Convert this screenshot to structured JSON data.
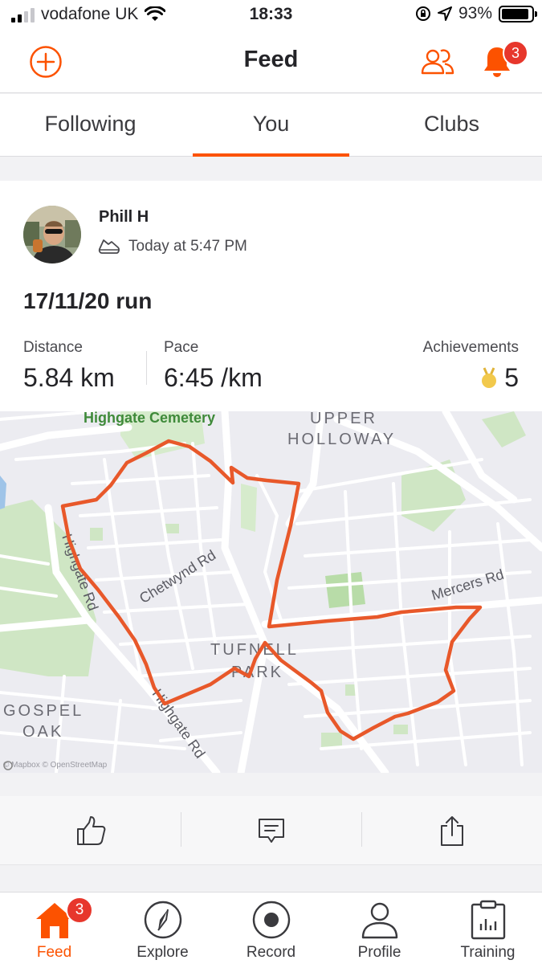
{
  "status_bar": {
    "carrier": "vodafone UK",
    "time": "18:33",
    "battery": "93%",
    "battery_level": 0.93
  },
  "header": {
    "title": "Feed",
    "notification_count": "3"
  },
  "tabs": [
    {
      "label": "Following",
      "active": false
    },
    {
      "label": "You",
      "active": true
    },
    {
      "label": "Clubs",
      "active": false
    }
  ],
  "activity": {
    "athlete": "Phill H",
    "timestamp": "Today at 5:47 PM",
    "title": "17/11/20 run",
    "stats": {
      "distance_label": "Distance",
      "distance_value": "5.84 km",
      "pace_label": "Pace",
      "pace_value": "6:45 /km",
      "achievements_label": "Achievements",
      "achievements_value": "5"
    }
  },
  "map": {
    "labels": {
      "cemetery": "Highgate Cemetery",
      "upper": "UPPER",
      "holloway": "HOLLOWAY",
      "chetwynd": "Chetwynd Rd",
      "mercers": "Mercers Rd",
      "tufnell": "TUFNELL",
      "park": "PARK",
      "gospel": "GOSPEL",
      "oak": "OAK",
      "highgate_rd_1": "Highgate Rd",
      "highgate_rd_2": "Highgate Rd"
    },
    "attribution": "© Mapbox © OpenStreetMap",
    "route_color": "#e8582a"
  },
  "bottom_nav": [
    {
      "label": "Feed",
      "active": true,
      "badge": "3"
    },
    {
      "label": "Explore",
      "active": false
    },
    {
      "label": "Record",
      "active": false
    },
    {
      "label": "Profile",
      "active": false
    },
    {
      "label": "Training",
      "active": false
    }
  ],
  "colors": {
    "accent": "#fc5200",
    "badge": "#e7372c",
    "medal": "#f2c94c"
  }
}
